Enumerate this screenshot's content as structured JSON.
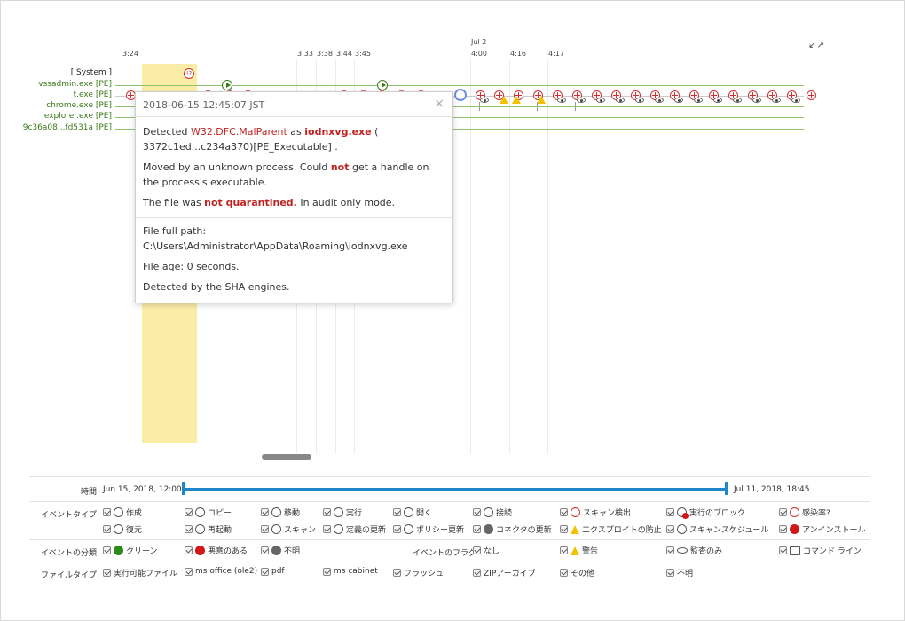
{
  "timeline": {
    "ticks": [
      {
        "label": "3:24"
      },
      {
        "label": "3:33"
      },
      {
        "label": "3:38"
      },
      {
        "label": "3:44"
      },
      {
        "label": "3:45"
      },
      {
        "label": "Jul 2"
      },
      {
        "label": "4:00"
      },
      {
        "label": "4:16"
      },
      {
        "label": "4:17"
      }
    ],
    "processes": [
      {
        "name": "[ System ]"
      },
      {
        "name": "vssadmin.exe [PE]"
      },
      {
        "name": "t.exe [PE]"
      },
      {
        "name": "chrome.exe [PE]"
      },
      {
        "name": "explorer.exe [PE]"
      },
      {
        "name": "9c36a08...fd531a [PE]"
      }
    ],
    "expand_icon": "expand-arrows-icon"
  },
  "popup": {
    "timestamp": "2018-06-15 12:45:07 JST",
    "close_icon": "×",
    "detected_prefix": "Detected ",
    "threat_name": "W32.DFC.MalParent",
    "as_text": " as ",
    "file_name": "iodnxvg.exe",
    "paren_open": " (",
    "hash": "3372c1ed...c234a370",
    "hash_suffix": ")[PE_Executable] .",
    "moved_1": "Moved by an unknown process. Could ",
    "moved_not": "not",
    "moved_2": " get a handle on the process's executable.",
    "quar_1": "The file was ",
    "quar_not": "not quarantined.",
    "quar_2": " In audit only mode.",
    "path_label": "File full path: ",
    "path_value": "C:\\Users\\Administrator\\AppData\\Roaming\\iodnxvg.exe",
    "age": "File age: 0 seconds.",
    "engine": "Detected by the SHA engines."
  },
  "filters": {
    "time_label": "時間",
    "time_start": "Jun 15, 2018, 12:00",
    "time_end": "Jul 11, 2018, 18:45",
    "event_type_label": "イベントタイプ",
    "event_types_row1": [
      "作成",
      "コピー",
      "移動",
      "実行",
      "開く",
      "接続",
      "スキャン検出",
      "実行のブロック",
      "感染率?"
    ],
    "event_types_row2": [
      "復元",
      "再起動",
      "スキャン",
      "定義の更新",
      "ポリシー更新",
      "コネクタの更新",
      "エクスプロイトの防止",
      "スキャンスケジュール",
      "アンインストール"
    ],
    "event_class_label": "イベントの分類",
    "event_classes": [
      "クリーン",
      "悪意のある",
      "不明"
    ],
    "event_flag_label": "イベントのフラグ",
    "event_flags": [
      "なし",
      "警告",
      "監査のみ",
      "コマンド ライン"
    ],
    "file_type_label": "ファイルタイプ",
    "file_types": [
      "実行可能ファイル",
      "ms office (ole2)",
      "pdf",
      "ms cabinet",
      "フラッシュ",
      "ZIPアーカイブ",
      "その他",
      "不明"
    ]
  },
  "colors": {
    "accent": "#1e86c9",
    "malicious": "#c0221f",
    "clean": "#2a8a1a",
    "highlight": "#fbeda6"
  }
}
